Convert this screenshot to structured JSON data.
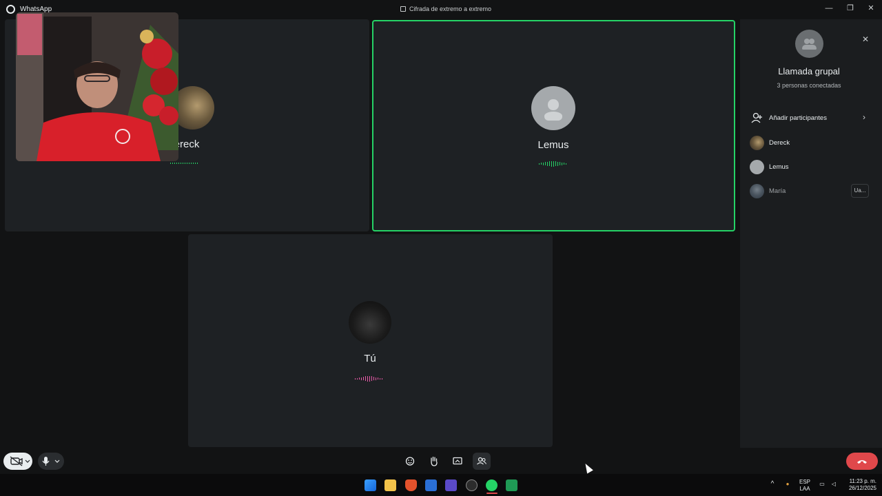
{
  "window": {
    "app_title": "WhatsApp",
    "encryption_label": "Cifrada de extremo a extremo",
    "minimize": "—",
    "restore": "❐",
    "close": "✕"
  },
  "tiles": [
    {
      "name": "Dereck",
      "visible_name": "ereck",
      "active": false
    },
    {
      "name": "Lemus",
      "active": true
    },
    {
      "name": "Tú",
      "active": false
    }
  ],
  "panel": {
    "title": "Llamada grupal",
    "subtitle": "3 personas conectadas",
    "add_participants_label": "Añadir participantes",
    "participants": [
      {
        "name": "Dereck",
        "status": "connected"
      },
      {
        "name": "Lemus",
        "status": "connected"
      },
      {
        "name": "María",
        "status": "ringing",
        "badge": "Ua..."
      }
    ]
  },
  "controls": {
    "icons": [
      "camera-off-icon",
      "mic-icon",
      "emoji-icon",
      "raise-hand-icon",
      "screen-share-icon",
      "participants-icon",
      "end-call-icon"
    ]
  },
  "taskbar": {
    "language_top": "ESP",
    "language_bottom": "LAA",
    "time": "11:23 p. m.",
    "date": "26/12/2025"
  },
  "colors": {
    "active_border": "#25d366",
    "end_call": "#e0484b",
    "wave_green": "#25d366",
    "wave_pink": "#e85aa8"
  }
}
